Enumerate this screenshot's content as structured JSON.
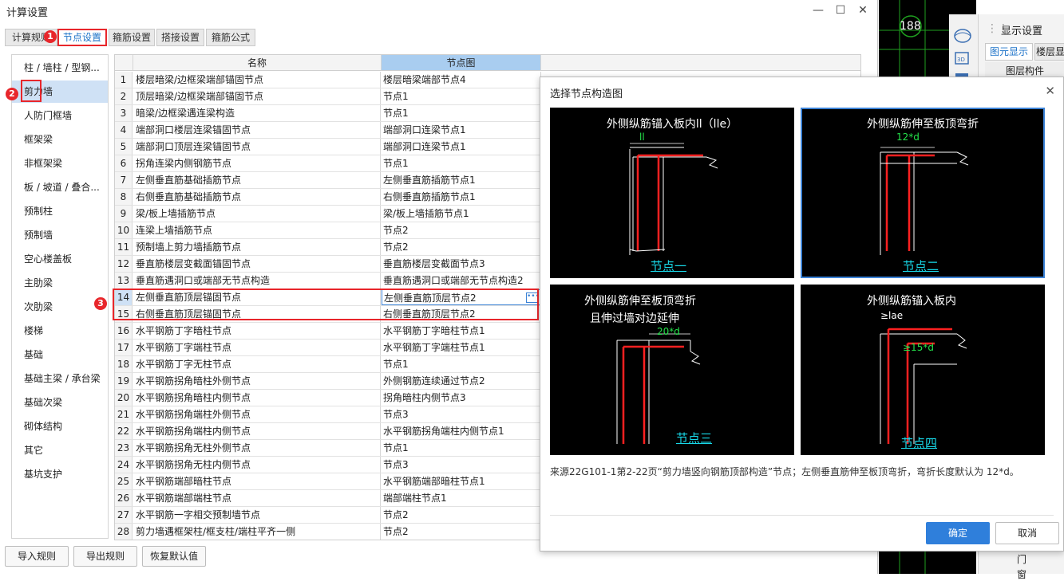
{
  "window": {
    "title": "计算设置"
  },
  "tabs": [
    {
      "label": "计算规则"
    },
    {
      "label": "节点设置"
    },
    {
      "label": "箍筋设置"
    },
    {
      "label": "搭接设置"
    },
    {
      "label": "箍筋公式"
    }
  ],
  "markers": [
    "1",
    "2",
    "3"
  ],
  "categories": [
    "柱 / 墙柱 / 型钢...",
    "剪力墙",
    "人防门框墙",
    "框架梁",
    "非框架梁",
    "板 / 坡道 / 叠合...",
    "预制柱",
    "预制墙",
    "空心楼盖板",
    "主肋梁",
    "次肋梁",
    "楼梯",
    "基础",
    "基础主梁 / 承台梁",
    "基础次梁",
    "砌体结构",
    "其它",
    "基坑支护"
  ],
  "grid": {
    "col_name": "名称",
    "col_node": "节点图",
    "rows": [
      {
        "n": "1",
        "name": "楼层暗梁/边框梁端部锚固节点",
        "node": "楼层暗梁端部节点4"
      },
      {
        "n": "2",
        "name": "顶层暗梁/边框梁端部锚固节点",
        "node": "节点1"
      },
      {
        "n": "3",
        "name": "暗梁/边框梁遇连梁构造",
        "node": "节点1"
      },
      {
        "n": "4",
        "name": "端部洞口楼层连梁锚固节点",
        "node": "端部洞口连梁节点1"
      },
      {
        "n": "5",
        "name": "端部洞口顶层连梁锚固节点",
        "node": "端部洞口连梁节点1"
      },
      {
        "n": "6",
        "name": "拐角连梁内侧钢筋节点",
        "node": "节点1"
      },
      {
        "n": "7",
        "name": "左侧垂直筋基础插筋节点",
        "node": "左侧垂直筋插筋节点1"
      },
      {
        "n": "8",
        "name": "右侧垂直筋基础插筋节点",
        "node": "右侧垂直筋插筋节点1"
      },
      {
        "n": "9",
        "name": "梁/板上墙插筋节点",
        "node": "梁/板上墙插筋节点1"
      },
      {
        "n": "10",
        "name": "连梁上墙插筋节点",
        "node": "节点2"
      },
      {
        "n": "11",
        "name": "预制墙上剪力墙插筋节点",
        "node": "节点2"
      },
      {
        "n": "12",
        "name": "垂直筋楼层变截面锚固节点",
        "node": "垂直筋楼层变截面节点3"
      },
      {
        "n": "13",
        "name": "垂直筋遇洞口或端部无节点构造",
        "node": "垂直筋遇洞口或端部无节点构造2"
      },
      {
        "n": "14",
        "name": "左侧垂直筋顶层锚固节点",
        "node": "左侧垂直筋顶层节点2"
      },
      {
        "n": "15",
        "name": "右侧垂直筋顶层锚固节点",
        "node": "右侧垂直筋顶层节点2"
      },
      {
        "n": "16",
        "name": "水平钢筋丁字暗柱节点",
        "node": "水平钢筋丁字暗柱节点1"
      },
      {
        "n": "17",
        "name": "水平钢筋丁字端柱节点",
        "node": "水平钢筋丁字端柱节点1"
      },
      {
        "n": "18",
        "name": "水平钢筋丁字无柱节点",
        "node": "节点1"
      },
      {
        "n": "19",
        "name": "水平钢筋拐角暗柱外侧节点",
        "node": "外侧钢筋连续通过节点2"
      },
      {
        "n": "20",
        "name": "水平钢筋拐角暗柱内侧节点",
        "node": "拐角暗柱内侧节点3"
      },
      {
        "n": "21",
        "name": "水平钢筋拐角端柱外侧节点",
        "node": "节点3"
      },
      {
        "n": "22",
        "name": "水平钢筋拐角端柱内侧节点",
        "node": "水平钢筋拐角端柱内侧节点1"
      },
      {
        "n": "23",
        "name": "水平钢筋拐角无柱外侧节点",
        "node": "节点1"
      },
      {
        "n": "24",
        "name": "水平钢筋拐角无柱内侧节点",
        "node": "节点3"
      },
      {
        "n": "25",
        "name": "水平钢筋端部暗柱节点",
        "node": "水平钢筋端部暗柱节点1"
      },
      {
        "n": "26",
        "name": "水平钢筋端部端柱节点",
        "node": "端部端柱节点1"
      },
      {
        "n": "27",
        "name": "水平钢筋一字相交预制墙节点",
        "node": "节点2"
      },
      {
        "n": "28",
        "name": "剪力墙遇框架柱/框支柱/端柱平齐一侧",
        "node": "节点2"
      }
    ]
  },
  "bottom_buttons": [
    "导入规则",
    "导出规则",
    "恢复默认值"
  ],
  "right_app": {
    "canvas_label": "188",
    "panel_title": "显示设置",
    "panel_tab1": "图元显示",
    "panel_tab2": "楼层显",
    "panel_header": "图层构件",
    "panel_item1": "门",
    "panel_item2": "窗"
  },
  "dialog": {
    "title": "选择节点构造图",
    "panels": [
      {
        "title": "外侧纵筋锚入板内ll（lle）",
        "dim": "ll",
        "label": "节点一"
      },
      {
        "title": "外侧纵筋伸至板顶弯折",
        "dim": "12*d",
        "label": "节点二"
      },
      {
        "title": "外侧纵筋伸至板顶弯折",
        "title2": "且伸过墙对边延伸",
        "dim": "20*d",
        "label": "节点三"
      },
      {
        "title": "外侧纵筋锚入板内",
        "dim": "≥lae",
        "dim2": "≥15*d",
        "label": "节点四"
      }
    ],
    "note": "来源22G101-1第2-22页“剪力墙竖向钢筋顶部构造”节点；左侧垂直筋伸至板顶弯折，弯折长度默认为 12*d。",
    "ok": "确定",
    "cancel": "取消"
  }
}
